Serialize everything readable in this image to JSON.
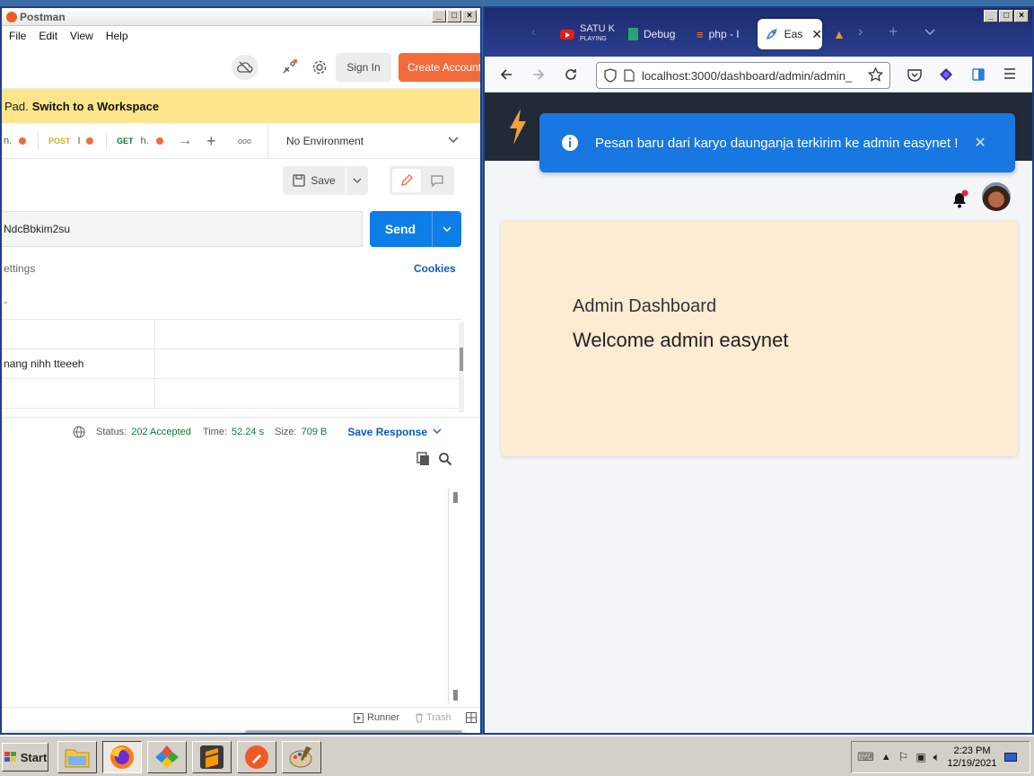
{
  "postman": {
    "title": "Postman",
    "menu": [
      "File",
      "Edit",
      "View",
      "Help"
    ],
    "sign_in": "Sign In",
    "create_account": "Create Account",
    "banner_prefix": "Pad.",
    "banner_link": "Switch to a Workspace",
    "tabs": [
      {
        "method": "",
        "label": "n.",
        "method_color": "#555"
      },
      {
        "method": "POST",
        "label": "I",
        "method_color": "#d4a72c"
      },
      {
        "method": "GET",
        "label": "h.",
        "method_color": "#0a7a3a"
      }
    ],
    "more_label": "ooo",
    "environment": "No Environment",
    "save_label": "Save",
    "url_value": "NdcBbkim2su",
    "send_label": "Send",
    "settings_label": "ettings",
    "cookies_label": "Cookies",
    "dash": "-",
    "params_rows": [
      "",
      "nang nihh tteeeh",
      ""
    ],
    "status_label": "Status:",
    "status_value": "202 Accepted",
    "time_label": "Time:",
    "time_value": "52.24 s",
    "size_label": "Size:",
    "size_value": "709 B",
    "save_response": "Save Response",
    "runner": "Runner",
    "trash": "Trash"
  },
  "firefox": {
    "tabs": [
      {
        "label": "SATU K",
        "sub": "PLAYING",
        "icon": "youtube-icon"
      },
      {
        "label": "Debug",
        "icon": "debug-icon"
      },
      {
        "label": "php - I",
        "icon": "stackoverflow-icon"
      },
      {
        "label": "Eas",
        "icon": "rocket-icon"
      },
      {
        "label": "",
        "icon": "mountain-icon"
      }
    ],
    "url": "localhost:3000/dashboard/admin/admin_",
    "toast": "Pesan baru dari karyo daunganja terkirim ke admin easynet !",
    "card_title": "Admin Dashboard",
    "card_welcome": "Welcome admin easynet",
    "colors": {
      "toast": "#1877e0",
      "card": "#fdebd3",
      "header": "#232a37",
      "bolt": "#f0a23a"
    }
  },
  "taskbar": {
    "start": "Start",
    "time": "2:23 PM",
    "date": "12/19/2021"
  }
}
